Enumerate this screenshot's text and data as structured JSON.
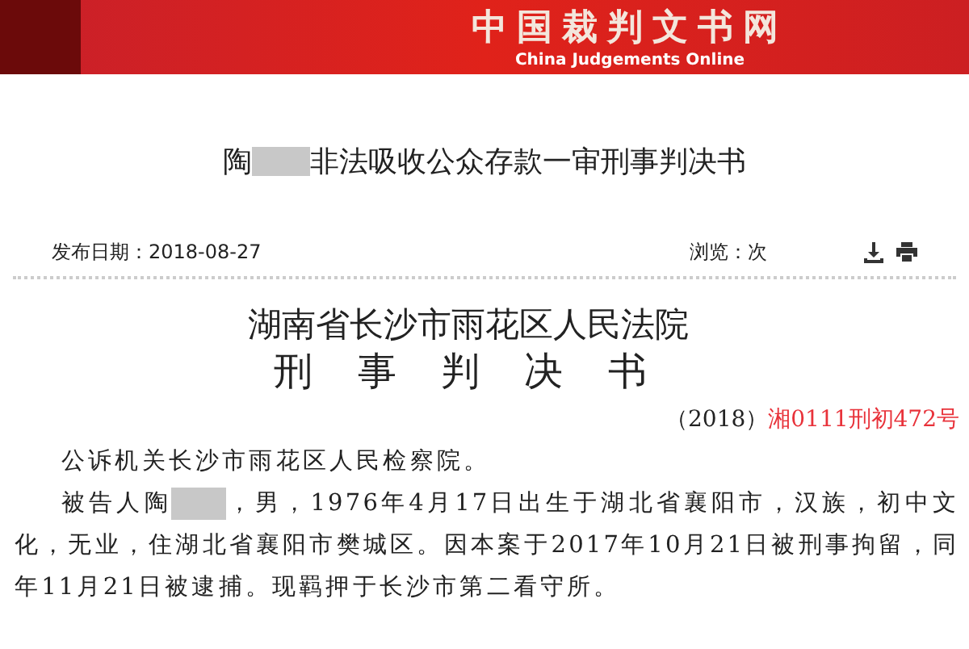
{
  "header": {
    "site_name": "中国裁判文书网",
    "site_name_en": "China Judgements Online"
  },
  "title": [
    {
      "kind": "text",
      "text": "陶"
    },
    {
      "kind": "redaction"
    },
    {
      "kind": "text",
      "text": "非法吸收公众存款一审刑事判决书"
    }
  ],
  "meta": {
    "publish_date": "发布日期：2018-08-27",
    "views": "浏览：次"
  },
  "document": {
    "court": "湖南省长沙市雨花区人民法院",
    "doc_type": "刑 事 判 决 书",
    "case_number": [
      {
        "kind": "plain",
        "text": "（2018）"
      },
      {
        "kind": "highlight",
        "text": "湘0111刑初472号"
      }
    ],
    "paragraphs": [
      [
        {
          "kind": "text",
          "text": "公诉机关长沙市雨花区人民检察院。"
        }
      ],
      [
        {
          "kind": "text",
          "text": "被告人陶"
        },
        {
          "kind": "redaction"
        },
        {
          "kind": "text",
          "text": "，男，1976年4月17日出生于湖北省襄阳市，汉族，初中文化，无业，住湖北省襄阳市樊城区。因本案于2017年10月21日被刑事拘留，同年11月21日被逮捕。现羁押于长沙市第二看守所。"
        }
      ]
    ]
  }
}
